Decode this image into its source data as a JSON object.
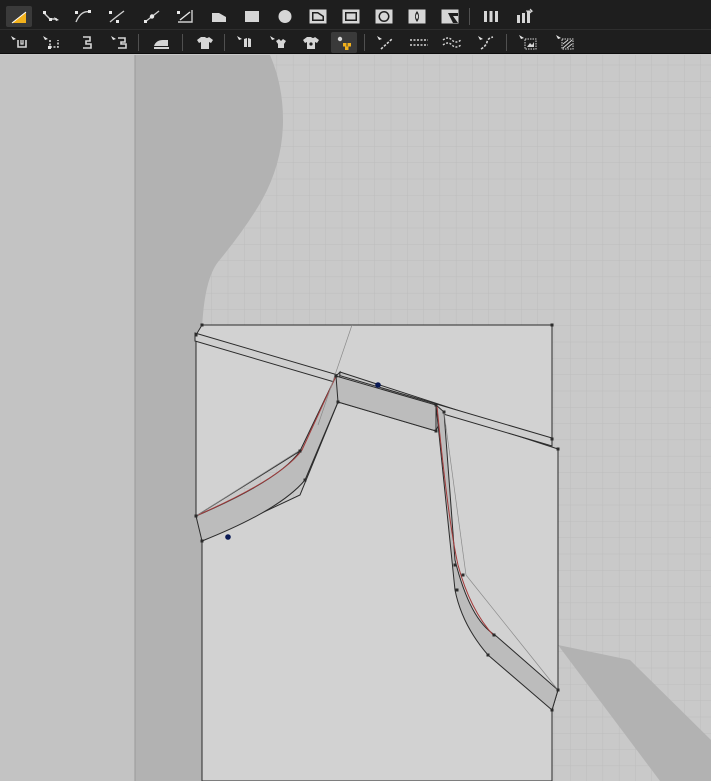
{
  "app": {
    "title": ""
  },
  "toolbar_top": {
    "tools": [
      {
        "id": "transform-pattern",
        "icon": "transform-pattern-icon",
        "active": true
      },
      {
        "id": "edit-point",
        "icon": "edit-point-icon"
      },
      {
        "id": "edit-curve-point",
        "icon": "edit-curve-point-icon"
      },
      {
        "id": "edit-segment",
        "icon": "edit-segment-icon"
      },
      {
        "id": "add-point",
        "icon": "add-point-icon"
      },
      {
        "id": "cut-curve",
        "icon": "cut-curve-icon"
      },
      {
        "id": "polygon",
        "icon": "polygon-icon"
      },
      {
        "id": "rectangle",
        "icon": "rectangle-icon"
      },
      {
        "id": "circle",
        "icon": "circle-icon"
      },
      {
        "id": "internal-polygon",
        "icon": "internal-polygon-icon"
      },
      {
        "id": "internal-rectangle",
        "icon": "internal-rectangle-icon"
      },
      {
        "id": "internal-circle",
        "icon": "internal-circle-icon"
      },
      {
        "id": "internal-diamond",
        "icon": "internal-diamond-icon"
      },
      {
        "id": "darts",
        "icon": "dart-icon"
      },
      {
        "id": "pleats",
        "icon": "pleat-icon"
      },
      {
        "id": "tuck",
        "icon": "tuck-icon"
      }
    ]
  },
  "toolbar_bottom": {
    "tools": [
      {
        "id": "segment-sewing",
        "icon": "segment-sewing-icon"
      },
      {
        "id": "free-sewing",
        "icon": "free-sewing-icon"
      },
      {
        "id": "m-n-segment-sewing",
        "icon": "m-n-segment-sewing-icon"
      },
      {
        "id": "m-n-free-sewing",
        "icon": "m-n-free-sewing-icon"
      },
      {
        "id": "steam",
        "icon": "iron-icon"
      },
      {
        "id": "pattern-fold",
        "icon": "shirt-icon"
      },
      {
        "id": "symmetry",
        "icon": "symmetry-icon"
      },
      {
        "id": "tack",
        "icon": "tack-icon"
      },
      {
        "id": "trim",
        "icon": "trim-icon"
      },
      {
        "id": "pin",
        "icon": "pin-icon",
        "active": true
      },
      {
        "id": "edit-topstitch",
        "icon": "topstitch-icon"
      },
      {
        "id": "segment-topstitch",
        "icon": "segment-topstitch-icon"
      },
      {
        "id": "free-topstitch",
        "icon": "free-topstitch-icon"
      },
      {
        "id": "puckering",
        "icon": "puckering-icon"
      },
      {
        "id": "graphic",
        "icon": "graphic-icon"
      },
      {
        "id": "texture",
        "icon": "texture-icon"
      }
    ]
  },
  "canvas": {
    "background": "#c9c9c9",
    "grid_color": "#bdbdbd",
    "avatar_silhouette_color": "#b2b2b2",
    "pattern_fill": "#d2d2d2",
    "seam_band_fill": "#bcbcbc",
    "outline_color": "#2b2b2b",
    "internal_line_color": "#a33a3a",
    "pin_color": "#0a1a55"
  }
}
